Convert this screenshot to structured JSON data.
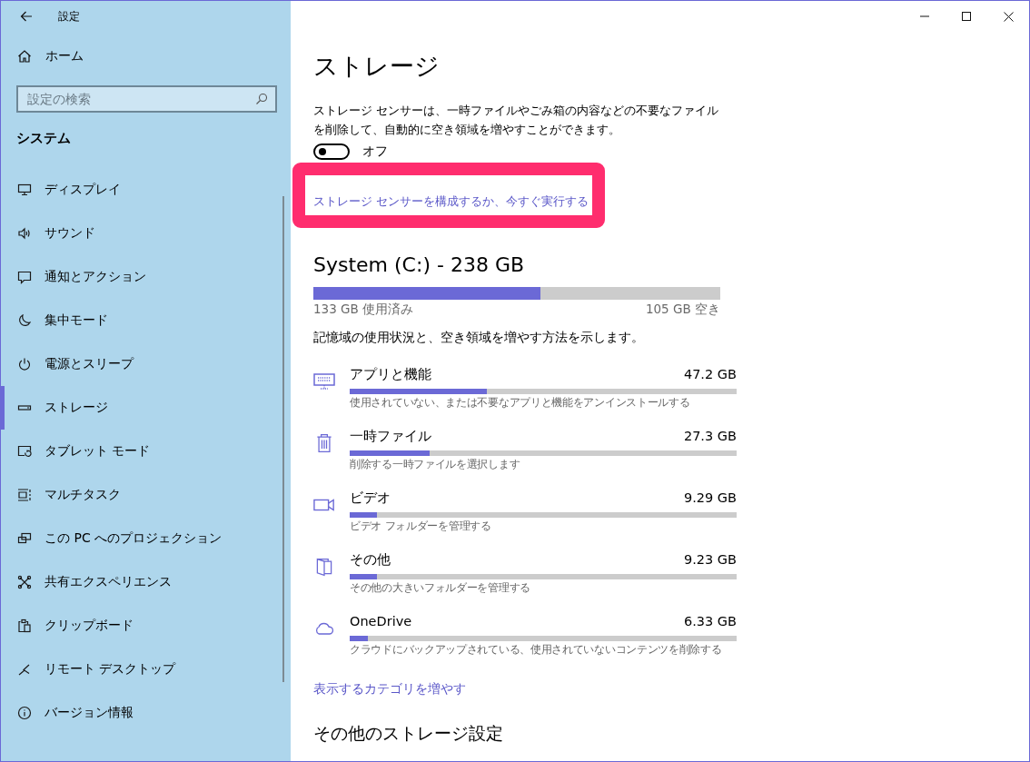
{
  "window": {
    "title": "設定"
  },
  "sidebar": {
    "home": "ホーム",
    "search": {
      "placeholder": "設定の検索"
    },
    "section": "システム",
    "items": [
      {
        "kind": "display",
        "label": "ディスプレイ",
        "selected": false
      },
      {
        "kind": "sound",
        "label": "サウンド",
        "selected": false
      },
      {
        "kind": "notification",
        "label": "通知とアクション",
        "selected": false
      },
      {
        "kind": "focus",
        "label": "集中モード",
        "selected": false
      },
      {
        "kind": "power",
        "label": "電源とスリープ",
        "selected": false
      },
      {
        "kind": "storage",
        "label": "ストレージ",
        "selected": true
      },
      {
        "kind": "tablet",
        "label": "タブレット モード",
        "selected": false
      },
      {
        "kind": "multitask",
        "label": "マルチタスク",
        "selected": false
      },
      {
        "kind": "projection",
        "label": "この PC へのプロジェクション",
        "selected": false
      },
      {
        "kind": "shared",
        "label": "共有エクスペリエンス",
        "selected": false
      },
      {
        "kind": "clipboard",
        "label": "クリップボード",
        "selected": false
      },
      {
        "kind": "remote",
        "label": "リモート デスクトップ",
        "selected": false
      },
      {
        "kind": "info",
        "label": "バージョン情報",
        "selected": false
      }
    ]
  },
  "main": {
    "title": "ストレージ",
    "sensor": {
      "description": "ストレージ センサーは、一時ファイルやごみ箱の内容などの不要なファイルを削除して、自動的に空き領域を増やすことができます。",
      "toggle": {
        "on": false,
        "label": "オフ"
      },
      "link": "ストレージ センサーを構成するか、今すぐ実行する",
      "highlighted": true
    },
    "drive": {
      "title": "System (C:) - 238 GB",
      "level": 0.558,
      "used": "133 GB 使用済み",
      "free": "105 GB 空き"
    },
    "intro": "記憶域の使用状況と、空き領域を増やす方法を示します。",
    "categories": [
      {
        "kind": "apps",
        "name": "アプリと機能",
        "size": "47.2 GB",
        "level": 0.354,
        "hint": "使用されていない、または不要なアプリと機能をアンインストールする"
      },
      {
        "kind": "temp",
        "name": "一時ファイル",
        "size": "27.3 GB",
        "level": 0.206,
        "hint": "削除する一時ファイルを選択します"
      },
      {
        "kind": "video",
        "name": "ビデオ",
        "size": "9.29 GB",
        "level": 0.07,
        "hint": "ビデオ フォルダーを管理する"
      },
      {
        "kind": "other",
        "name": "その他",
        "size": "9.23 GB",
        "level": 0.07,
        "hint": "その他の大きいフォルダーを管理する"
      },
      {
        "kind": "cloud",
        "name": "OneDrive",
        "size": "6.33 GB",
        "level": 0.048,
        "hint": "クラウドにバックアップされている、使用されていないコンテンツを削除する"
      }
    ],
    "more_link": "表示するカテゴリを増やす",
    "other_heading": "その他のストレージ設定"
  }
}
